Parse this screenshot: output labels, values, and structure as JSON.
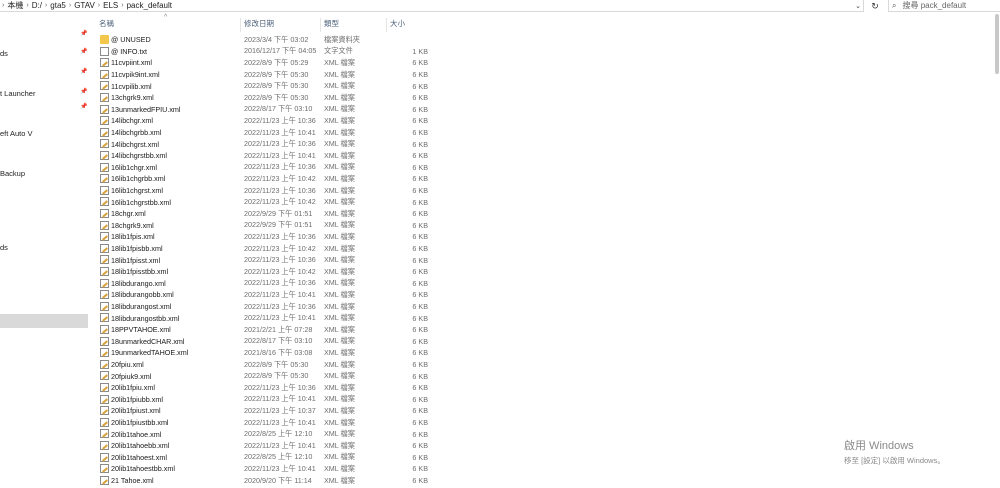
{
  "address": {
    "segments": [
      "本機",
      "D:/",
      "gta5",
      "GTAV",
      "ELS",
      "pack_default"
    ],
    "separator": "›",
    "dropdown_icon": "chevron-down-icon",
    "refresh_icon": "refresh-icon"
  },
  "search": {
    "placeholder": "搜尋 pack_default",
    "icon": "search-icon"
  },
  "nav": {
    "items": [
      {
        "label": "",
        "pinned": true,
        "selected": false
      },
      {
        "label": "ds",
        "pinned": true,
        "selected": false
      },
      {
        "label": "",
        "pinned": true,
        "selected": false
      },
      {
        "label": "t Launcher",
        "pinned": true,
        "selected": false
      },
      {
        "label": "",
        "pinned": true,
        "selected": false
      },
      {
        "label": "eft Auto V",
        "pinned": false,
        "selected": false
      },
      {
        "label": "",
        "pinned": false,
        "selected": false
      },
      {
        "label": "Backup",
        "pinned": false,
        "selected": false
      },
      {
        "label": "ds",
        "pinned": false,
        "selected": false
      },
      {
        "label": "",
        "pinned": false,
        "selected": true
      }
    ]
  },
  "columns": {
    "name": "名稱",
    "date": "修改日期",
    "type": "類型",
    "size": "大小"
  },
  "files": [
    {
      "name": "@ UNUSED",
      "date": "2023/3/4 下午 03:02",
      "type": "檔案資料夾",
      "size": "",
      "icon": "folder"
    },
    {
      "name": "@ INFO.txt",
      "date": "2016/12/17 下午 04:05",
      "type": "文字文件",
      "size": "1 KB",
      "icon": "txt"
    },
    {
      "name": "11cvpiint.xml",
      "date": "2022/8/9 下午 05:29",
      "type": "XML 檔案",
      "size": "6 KB",
      "icon": "xml"
    },
    {
      "name": "11cvpik9int.xml",
      "date": "2022/8/9 下午 05:30",
      "type": "XML 檔案",
      "size": "6 KB",
      "icon": "xml"
    },
    {
      "name": "11cvpilib.xml",
      "date": "2022/8/9 下午 05:30",
      "type": "XML 檔案",
      "size": "6 KB",
      "icon": "xml"
    },
    {
      "name": "13chgrk9.xml",
      "date": "2022/8/9 下午 05:30",
      "type": "XML 檔案",
      "size": "6 KB",
      "icon": "xml"
    },
    {
      "name": "13unmarkedFPIU.xml",
      "date": "2022/8/17 下午 03:10",
      "type": "XML 檔案",
      "size": "6 KB",
      "icon": "xml"
    },
    {
      "name": "14libchgr.xml",
      "date": "2022/11/23 上午 10:36",
      "type": "XML 檔案",
      "size": "6 KB",
      "icon": "xml"
    },
    {
      "name": "14libchgrbb.xml",
      "date": "2022/11/23 上午 10:41",
      "type": "XML 檔案",
      "size": "6 KB",
      "icon": "xml"
    },
    {
      "name": "14libchgrst.xml",
      "date": "2022/11/23 上午 10:36",
      "type": "XML 檔案",
      "size": "6 KB",
      "icon": "xml"
    },
    {
      "name": "14libchgrstbb.xml",
      "date": "2022/11/23 上午 10:41",
      "type": "XML 檔案",
      "size": "6 KB",
      "icon": "xml"
    },
    {
      "name": "16lib1chgr.xml",
      "date": "2022/11/23 上午 10:36",
      "type": "XML 檔案",
      "size": "6 KB",
      "icon": "xml"
    },
    {
      "name": "16lib1chgrbb.xml",
      "date": "2022/11/23 上午 10:42",
      "type": "XML 檔案",
      "size": "6 KB",
      "icon": "xml"
    },
    {
      "name": "16lib1chgrst.xml",
      "date": "2022/11/23 上午 10:36",
      "type": "XML 檔案",
      "size": "6 KB",
      "icon": "xml"
    },
    {
      "name": "16lib1chgrstbb.xml",
      "date": "2022/11/23 上午 10:42",
      "type": "XML 檔案",
      "size": "6 KB",
      "icon": "xml"
    },
    {
      "name": "18chgr.xml",
      "date": "2022/9/29 下午 01:51",
      "type": "XML 檔案",
      "size": "6 KB",
      "icon": "xml"
    },
    {
      "name": "18chgrk9.xml",
      "date": "2022/9/29 下午 01:51",
      "type": "XML 檔案",
      "size": "6 KB",
      "icon": "xml"
    },
    {
      "name": "18lib1fpis.xml",
      "date": "2022/11/23 上午 10:36",
      "type": "XML 檔案",
      "size": "6 KB",
      "icon": "xml"
    },
    {
      "name": "18lib1fpisbb.xml",
      "date": "2022/11/23 上午 10:42",
      "type": "XML 檔案",
      "size": "6 KB",
      "icon": "xml"
    },
    {
      "name": "18lib1fpisst.xml",
      "date": "2022/11/23 上午 10:36",
      "type": "XML 檔案",
      "size": "6 KB",
      "icon": "xml"
    },
    {
      "name": "18lib1fpisstbb.xml",
      "date": "2022/11/23 上午 10:42",
      "type": "XML 檔案",
      "size": "6 KB",
      "icon": "xml"
    },
    {
      "name": "18libdurango.xml",
      "date": "2022/11/23 上午 10:36",
      "type": "XML 檔案",
      "size": "6 KB",
      "icon": "xml"
    },
    {
      "name": "18libdurangobb.xml",
      "date": "2022/11/23 上午 10:41",
      "type": "XML 檔案",
      "size": "6 KB",
      "icon": "xml"
    },
    {
      "name": "18libdurangost.xml",
      "date": "2022/11/23 上午 10:36",
      "type": "XML 檔案",
      "size": "6 KB",
      "icon": "xml"
    },
    {
      "name": "18libdurangostbb.xml",
      "date": "2022/11/23 上午 10:41",
      "type": "XML 檔案",
      "size": "6 KB",
      "icon": "xml"
    },
    {
      "name": "18PPVTAHOE.xml",
      "date": "2021/2/21 上午 07:28",
      "type": "XML 檔案",
      "size": "6 KB",
      "icon": "xml"
    },
    {
      "name": "18unmarkedCHAR.xml",
      "date": "2022/8/17 下午 03:10",
      "type": "XML 檔案",
      "size": "6 KB",
      "icon": "xml"
    },
    {
      "name": "19unmarkedTAHOE.xml",
      "date": "2021/8/16 下午 03:08",
      "type": "XML 檔案",
      "size": "6 KB",
      "icon": "xml"
    },
    {
      "name": "20fpiu.xml",
      "date": "2022/8/9 下午 05:30",
      "type": "XML 檔案",
      "size": "6 KB",
      "icon": "xml"
    },
    {
      "name": "20fpiuk9.xml",
      "date": "2022/8/9 下午 05:30",
      "type": "XML 檔案",
      "size": "6 KB",
      "icon": "xml"
    },
    {
      "name": "20lib1fpiu.xml",
      "date": "2022/11/23 上午 10:36",
      "type": "XML 檔案",
      "size": "6 KB",
      "icon": "xml"
    },
    {
      "name": "20lib1fpiubb.xml",
      "date": "2022/11/23 上午 10:41",
      "type": "XML 檔案",
      "size": "6 KB",
      "icon": "xml"
    },
    {
      "name": "20lib1fpiust.xml",
      "date": "2022/11/23 上午 10:37",
      "type": "XML 檔案",
      "size": "6 KB",
      "icon": "xml"
    },
    {
      "name": "20lib1fpiustbb.xml",
      "date": "2022/11/23 上午 10:41",
      "type": "XML 檔案",
      "size": "6 KB",
      "icon": "xml"
    },
    {
      "name": "20lib1tahoe.xml",
      "date": "2022/8/25 上午 12:10",
      "type": "XML 檔案",
      "size": "6 KB",
      "icon": "xml"
    },
    {
      "name": "20lib1tahoebb.xml",
      "date": "2022/11/23 上午 10:41",
      "type": "XML 檔案",
      "size": "6 KB",
      "icon": "xml"
    },
    {
      "name": "20lib1tahoest.xml",
      "date": "2022/8/25 上午 12:10",
      "type": "XML 檔案",
      "size": "6 KB",
      "icon": "xml"
    },
    {
      "name": "20lib1tahoestbb.xml",
      "date": "2022/11/23 上午 10:41",
      "type": "XML 檔案",
      "size": "6 KB",
      "icon": "xml"
    },
    {
      "name": "21 Tahoe.xml",
      "date": "2020/9/20 下午 11:14",
      "type": "XML 檔案",
      "size": "6 KB",
      "icon": "xml"
    }
  ],
  "watermark": {
    "title": "啟用 Windows",
    "subtitle": "移至 [設定] 以啟用 Windows。"
  },
  "colors": {
    "folder": "#f3c64c",
    "selected_nav": "#d9d9d9",
    "header_text": "#4c607a",
    "secondary_text": "#6d6d6d"
  }
}
